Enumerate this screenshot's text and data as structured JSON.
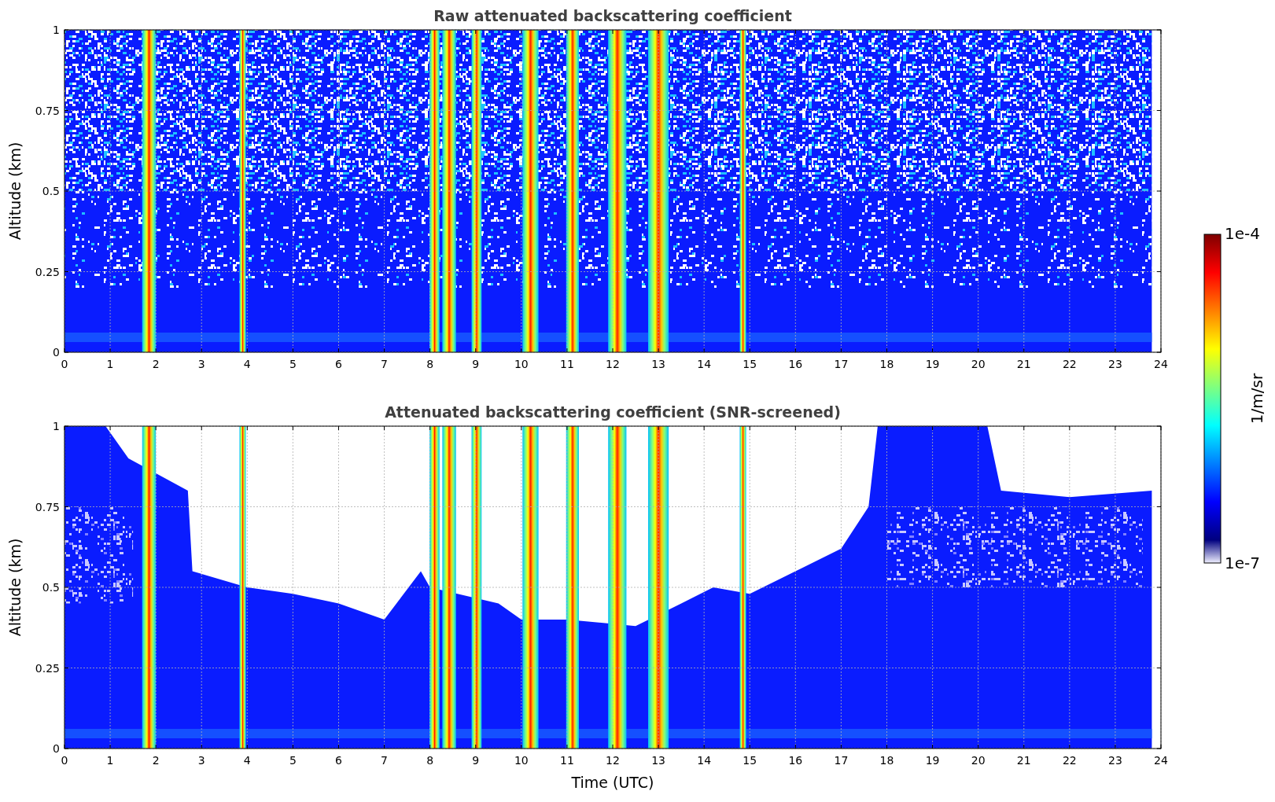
{
  "panels": [
    {
      "kind": "raw",
      "title": "Raw attenuated backscattering coefficient",
      "ylabel": "Altitude (km)",
      "xticks": [
        "0",
        "1",
        "2",
        "3",
        "4",
        "5",
        "6",
        "7",
        "8",
        "9",
        "10",
        "11",
        "12",
        "13",
        "14",
        "15",
        "16",
        "17",
        "18",
        "19",
        "20",
        "21",
        "22",
        "23",
        "24"
      ],
      "yticks": [
        "1",
        "0.75",
        "0.5",
        "0.25",
        "0"
      ]
    },
    {
      "kind": "screened",
      "title": "Attenuated backscattering coefficient (SNR-screened)",
      "ylabel": "Altitude (km)",
      "xlabel": "Time (UTC)",
      "xticks": [
        "0",
        "1",
        "2",
        "3",
        "4",
        "5",
        "6",
        "7",
        "8",
        "9",
        "10",
        "11",
        "12",
        "13",
        "14",
        "15",
        "16",
        "17",
        "18",
        "19",
        "20",
        "21",
        "22",
        "23",
        "24"
      ],
      "yticks": [
        "1",
        "0.75",
        "0.5",
        "0.25",
        "0"
      ]
    }
  ],
  "colorbar": {
    "label": "1/m/sr",
    "max_label": "1e-4",
    "min_label": "1e-7"
  }
}
